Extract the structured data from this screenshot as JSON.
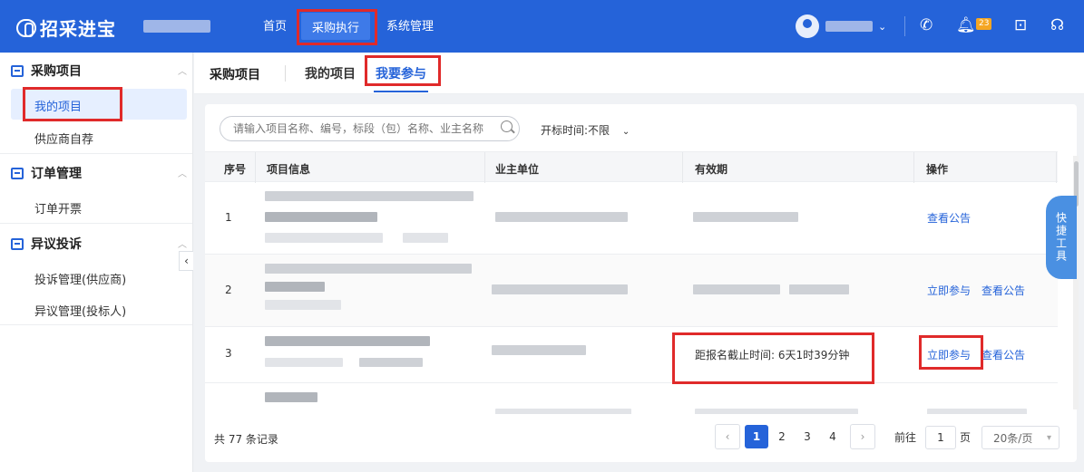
{
  "brand": {
    "name": "招采进宝"
  },
  "nav": {
    "items": [
      "首页",
      "采购执行",
      "系统管理"
    ],
    "active": "采购执行"
  },
  "header": {
    "notification_count": "23"
  },
  "sidebar": {
    "groups": [
      {
        "label": "采购项目",
        "items": [
          "我的项目",
          "供应商自荐"
        ]
      },
      {
        "label": "订单管理",
        "items": [
          "订单开票"
        ]
      },
      {
        "label": "异议投诉",
        "items": [
          "投诉管理(供应商)",
          "异议管理(投标人)"
        ]
      }
    ],
    "active_item": "我的项目"
  },
  "tabs": {
    "title": "采购项目",
    "items": [
      "我的项目",
      "我要参与"
    ],
    "active": "我要参与"
  },
  "filters": {
    "search_placeholder": "请输入项目名称、编号，标段（包）名称、业主名称",
    "open_time": "开标时间:不限"
  },
  "table": {
    "columns": [
      "序号",
      "项目信息",
      "业主单位",
      "有效期",
      "操作"
    ],
    "rows": [
      {
        "index": "1",
        "validity": "",
        "actions": [
          "查看公告"
        ]
      },
      {
        "index": "2",
        "validity": "",
        "actions": [
          "立即参与",
          "查看公告"
        ]
      },
      {
        "index": "3",
        "validity": "距报名截止时间:  6天1时39分钟",
        "actions": [
          "立即参与",
          "查看公告"
        ]
      }
    ]
  },
  "quick_tools": {
    "label": "快捷工具"
  },
  "pagination": {
    "total": "共 77 条记录",
    "pages": [
      "1",
      "2",
      "3",
      "4"
    ],
    "current": "1",
    "goto_prefix": "前往",
    "goto_value": "1",
    "goto_suffix": "页",
    "page_size": "20条/页"
  }
}
